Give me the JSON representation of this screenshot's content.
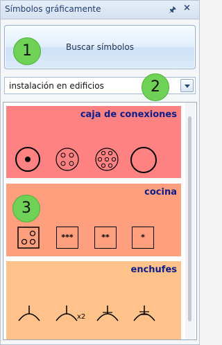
{
  "panel": {
    "title": "Símbolos gráficamente",
    "pin_icon": "pin-icon",
    "close_icon": "close-icon"
  },
  "search": {
    "label": "Buscar símbolos"
  },
  "combo": {
    "value": "instalación en edificios"
  },
  "badges": [
    "1",
    "2",
    "3"
  ],
  "groups": [
    {
      "title": "caja de conexiones",
      "color": "#ff8283",
      "symbols": [
        "junction-box-dot-icon",
        "junction-box-4pin-icon",
        "junction-box-6pin-icon",
        "junction-box-empty-icon"
      ]
    },
    {
      "title": "cocina",
      "color": "#ff9f7e",
      "symbols": [
        "stove-burners-icon",
        "stove-3-star-icon",
        "stove-2-star-icon",
        "stove-1-star-icon"
      ],
      "labels": [
        "***",
        "**",
        "*"
      ]
    },
    {
      "title": "enchufes",
      "color": "#ffc28a",
      "symbols": [
        "socket-single-icon",
        "socket-double-icon",
        "socket-triple-icon",
        "socket-quad-icon"
      ],
      "double_label": "x2"
    }
  ]
}
